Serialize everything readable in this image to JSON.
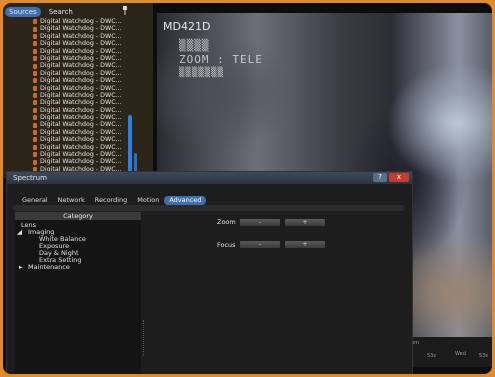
{
  "sources": {
    "tabs": [
      "Sources",
      "Search"
    ],
    "items": [
      "Digital Watchdog - DWC...",
      "Digital Watchdog - DWC...",
      "Digital Watchdog - DWC...",
      "Digital Watchdog - DWC...",
      "Digital Watchdog - DWC...",
      "Digital Watchdog - DWC...",
      "Digital Watchdog - DWC...",
      "Digital Watchdog - DWC...",
      "Digital Watchdog - DWC...",
      "Digital Watchdog - DWC...",
      "Digital Watchdog - DWC...",
      "Digital Watchdog - DWC...",
      "Digital Watchdog - DWC...",
      "Digital Watchdog - DWC...",
      "Digital Watchdog - DWC...",
      "Digital Watchdog - DWC...",
      "Digital Watchdog - DWC...",
      "Digital Watchdog - DWC...",
      "Digital Watchdog - DWC...",
      "Digital Watchdog - DWC...",
      "Digital Watchdog - DWC..."
    ]
  },
  "video": {
    "camera_name": "MD421D",
    "osd_line2": "ZOOM : TELE"
  },
  "timeline": {
    "labels": [
      "pm",
      "53s",
      "Wed",
      "53s"
    ]
  },
  "dialog": {
    "title": "Spectrum",
    "help_label": "?",
    "close_label": "x",
    "tabs": [
      "General",
      "Network",
      "Recording",
      "Motion",
      "Advanced"
    ],
    "active_tab": "Advanced",
    "category_header": "Category",
    "tree": {
      "lens": "Lens",
      "imaging": "Imaging",
      "white_balance": "White Balance",
      "exposure": "Exposure",
      "day_night": "Day & Night",
      "extra": "Extra Setting",
      "maintenance": "Maintenance"
    },
    "zoom": {
      "label": "Zoom",
      "minus": "-",
      "plus": "+"
    },
    "focus": {
      "label": "Focus",
      "minus": "-",
      "plus": "+"
    }
  },
  "colors": {
    "accent": "#3f6fb0",
    "frame": "#e08a2a",
    "close": "#c83a2a"
  }
}
